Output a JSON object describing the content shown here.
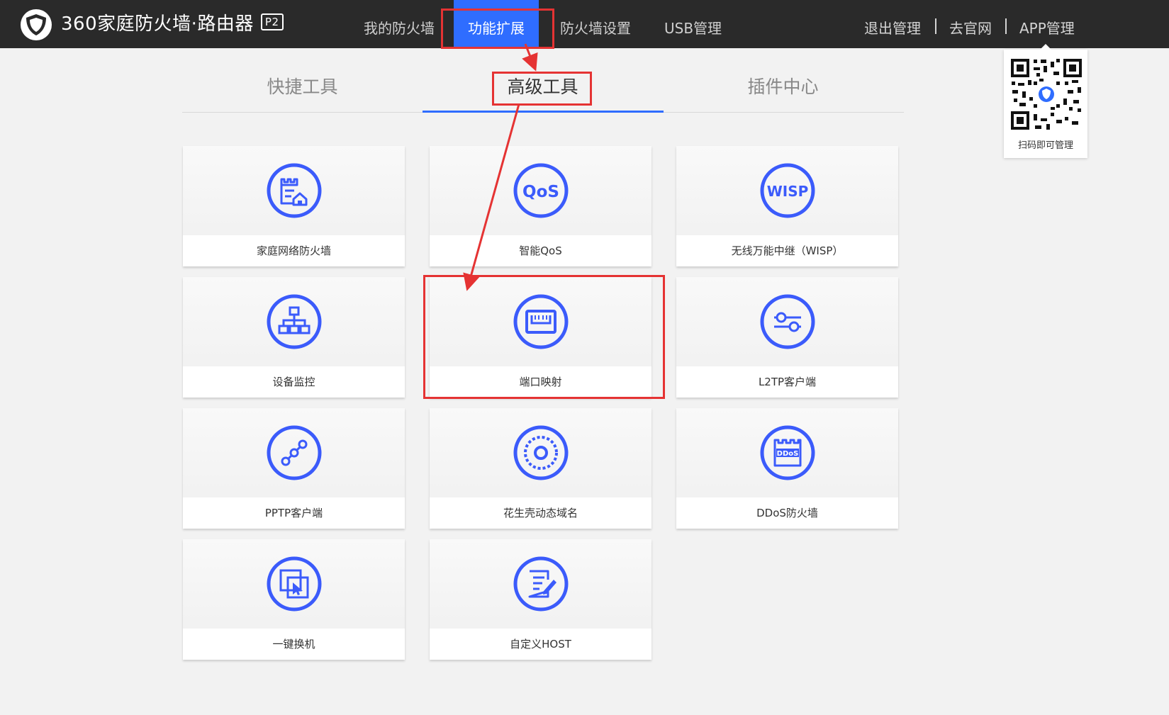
{
  "header": {
    "brand": "360家庭防火墙·路由器",
    "badge": "P2",
    "nav": [
      "我的防火墙",
      "功能扩展",
      "防火墙设置",
      "USB管理"
    ],
    "right_nav": [
      "退出管理",
      "去官网",
      "APP管理"
    ],
    "active_color": "#2f6dff"
  },
  "qr": {
    "caption": "扫码即可管理"
  },
  "tabs": [
    "快捷工具",
    "高级工具",
    "插件中心"
  ],
  "tools": [
    {
      "label": "家庭网络防火墙",
      "icon": "home-firewall-icon"
    },
    {
      "label": "智能QoS",
      "icon": "qos-icon"
    },
    {
      "label": "无线万能中继（WISP）",
      "icon": "wisp-icon"
    },
    {
      "label": "设备监控",
      "icon": "device-monitor-icon"
    },
    {
      "label": "端口映射",
      "icon": "port-mapping-icon"
    },
    {
      "label": "L2TP客户端",
      "icon": "l2tp-sliders-icon"
    },
    {
      "label": "PPTP客户端",
      "icon": "pptp-link-icon"
    },
    {
      "label": "花生壳动态域名",
      "icon": "dynamic-dns-icon"
    },
    {
      "label": "DDoS防火墙",
      "icon": "ddos-firewall-icon"
    },
    {
      "label": "一键换机",
      "icon": "one-key-switch-icon"
    },
    {
      "label": "自定义HOST",
      "icon": "custom-host-icon"
    }
  ],
  "icon_texts": {
    "qos": "QoS",
    "wisp": "WISP",
    "ddos": "DDoS"
  },
  "annotation_color": "#e53333"
}
